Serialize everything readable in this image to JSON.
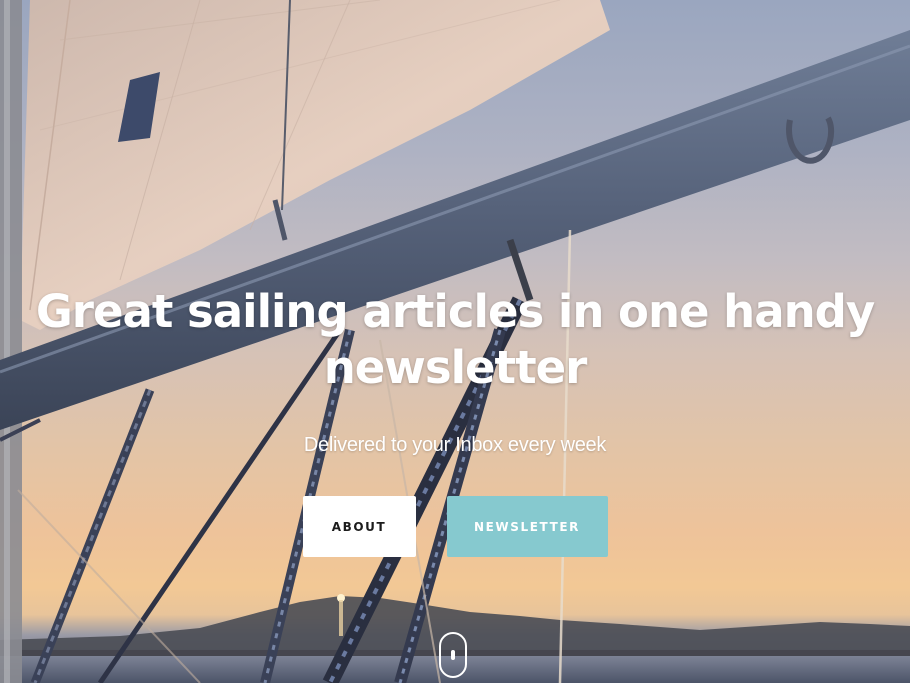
{
  "hero": {
    "title_line1": "Great sailing articles in one handy",
    "title_line2": "newsletter",
    "subtitle": "Delivered to your Inbox every week",
    "buttons": {
      "about_label": "ABOUT",
      "newsletter_label": "NEWSLETTER"
    },
    "background_image": "sailboat-sail-and-rigging-at-sunset",
    "scroll_icon": "mouse-scroll-icon"
  },
  "colors": {
    "newsletter_button": "#86c9cf",
    "about_button": "#ffffff",
    "text": "#ffffff"
  }
}
